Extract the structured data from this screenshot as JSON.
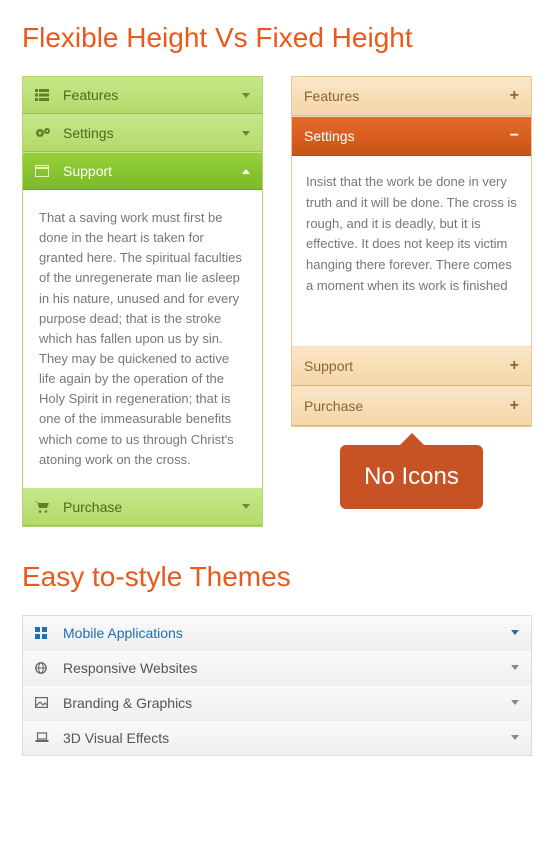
{
  "heading1": "Flexible Height Vs Fixed Height",
  "heading2": "Easy to-style Themes",
  "green": {
    "items": [
      {
        "label": "Features"
      },
      {
        "label": "Settings"
      },
      {
        "label": "Support"
      },
      {
        "label": "Purchase"
      }
    ],
    "body": "That a saving work must first be done in the heart is taken for granted here. The spiritual faculties of the unregenerate man lie asleep in his nature, unused and for every purpose dead; that is the stroke which has fallen upon us by sin. They may be quickened to active life again by the operation of the Holy Spirit in regeneration; that is one of the immeasurable benefits which come to us through Christ's atoning work on the cross."
  },
  "orange": {
    "items": [
      {
        "label": "Features"
      },
      {
        "label": "Settings"
      },
      {
        "label": "Support"
      },
      {
        "label": "Purchase"
      }
    ],
    "body": "Insist that the work be done in very truth and it will be done. The cross is rough, and it is deadly, but it is effective. It does not keep its victim hanging there forever. There comes a moment when its work is finished"
  },
  "badge": "No Icons",
  "grey": {
    "items": [
      {
        "label": "Mobile Applications"
      },
      {
        "label": "Responsive Websites"
      },
      {
        "label": "Branding & Graphics"
      },
      {
        "label": "3D Visual Effects"
      }
    ]
  }
}
